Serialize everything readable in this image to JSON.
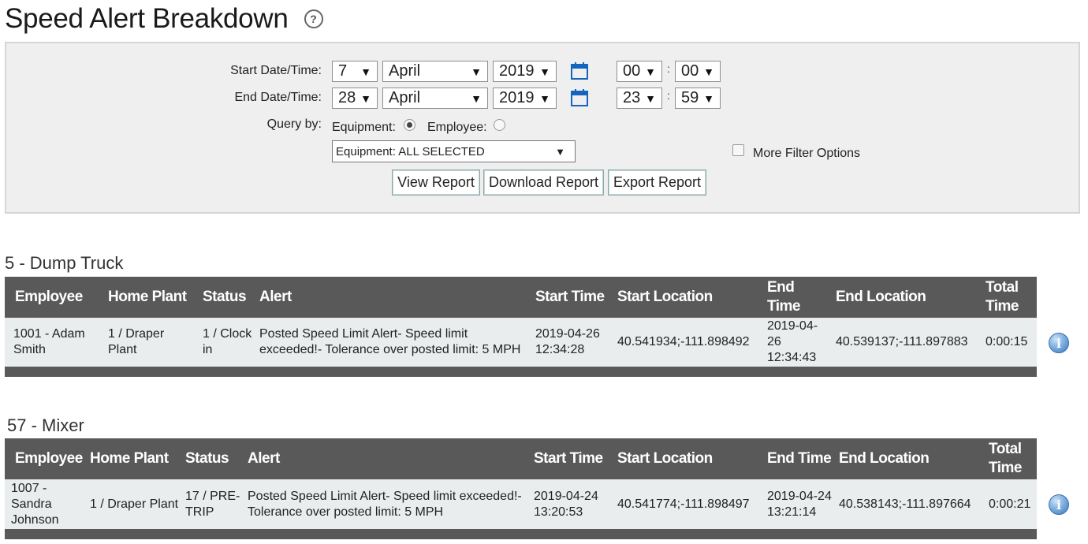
{
  "page": {
    "title": "Speed Alert Breakdown"
  },
  "filters": {
    "start_label": "Start Date/Time:",
    "end_label": "End Date/Time:",
    "start": {
      "day": "7",
      "month": "April",
      "year": "2019",
      "hour": "00",
      "minute": "00"
    },
    "end": {
      "day": "28",
      "month": "April",
      "year": "2019",
      "hour": "23",
      "minute": "59"
    },
    "colon": ":",
    "query_label": "Query by:",
    "equipment_label": "Equipment:",
    "employee_label": "Employee:",
    "equipment_select": "Equipment: ALL SELECTED",
    "more_filter_label": "More Filter Options",
    "buttons": {
      "view": "View Report",
      "download": "Download Report",
      "export": "Export Report"
    }
  },
  "columns": {
    "employee": "Employee",
    "home_plant": "Home Plant",
    "status": "Status",
    "alert": "Alert",
    "start_time": "Start Time",
    "start_location": "Start Location",
    "end_time": "End Time",
    "end_location": "End Location",
    "total_time": "Total Time"
  },
  "sections": [
    {
      "title": "5 - Dump Truck",
      "row": {
        "employee": "1001 - Adam Smith",
        "home_plant": "1 / Draper Plant",
        "status": "1 / Clock in",
        "alert": "Posted Speed Limit Alert- Speed limit exceeded!- Tolerance over posted limit: 5 MPH",
        "start_time": "2019-04-26 12:34:28",
        "start_location": "40.541934;-111.898492",
        "end_time": "2019-04-26 12:34:43",
        "end_location": "40.539137;-111.897883",
        "total_time": "0:00:15"
      }
    },
    {
      "title": "57 - Mixer",
      "row": {
        "employee": "1007 - Sandra Johnson",
        "home_plant": "1 / Draper Plant",
        "status": "17 / PRE-TRIP",
        "alert": "Posted Speed Limit Alert- Speed limit exceeded!- Tolerance over posted limit: 5 MPH",
        "start_time": "2019-04-24 13:20:53",
        "start_location": "40.541774;-111.898497",
        "end_time": "2019-04-24 13:21:14",
        "end_location": "40.538143;-111.897664",
        "total_time": "0:00:21"
      }
    }
  ],
  "icons": {
    "help": "help-circle-icon",
    "calendar": "calendar-icon",
    "info": "info-icon"
  },
  "colors": {
    "header_bg": "#595959",
    "row_bg": "#e9eded",
    "panel_bg": "#efefef",
    "calendar_blue": "#1565c0"
  }
}
